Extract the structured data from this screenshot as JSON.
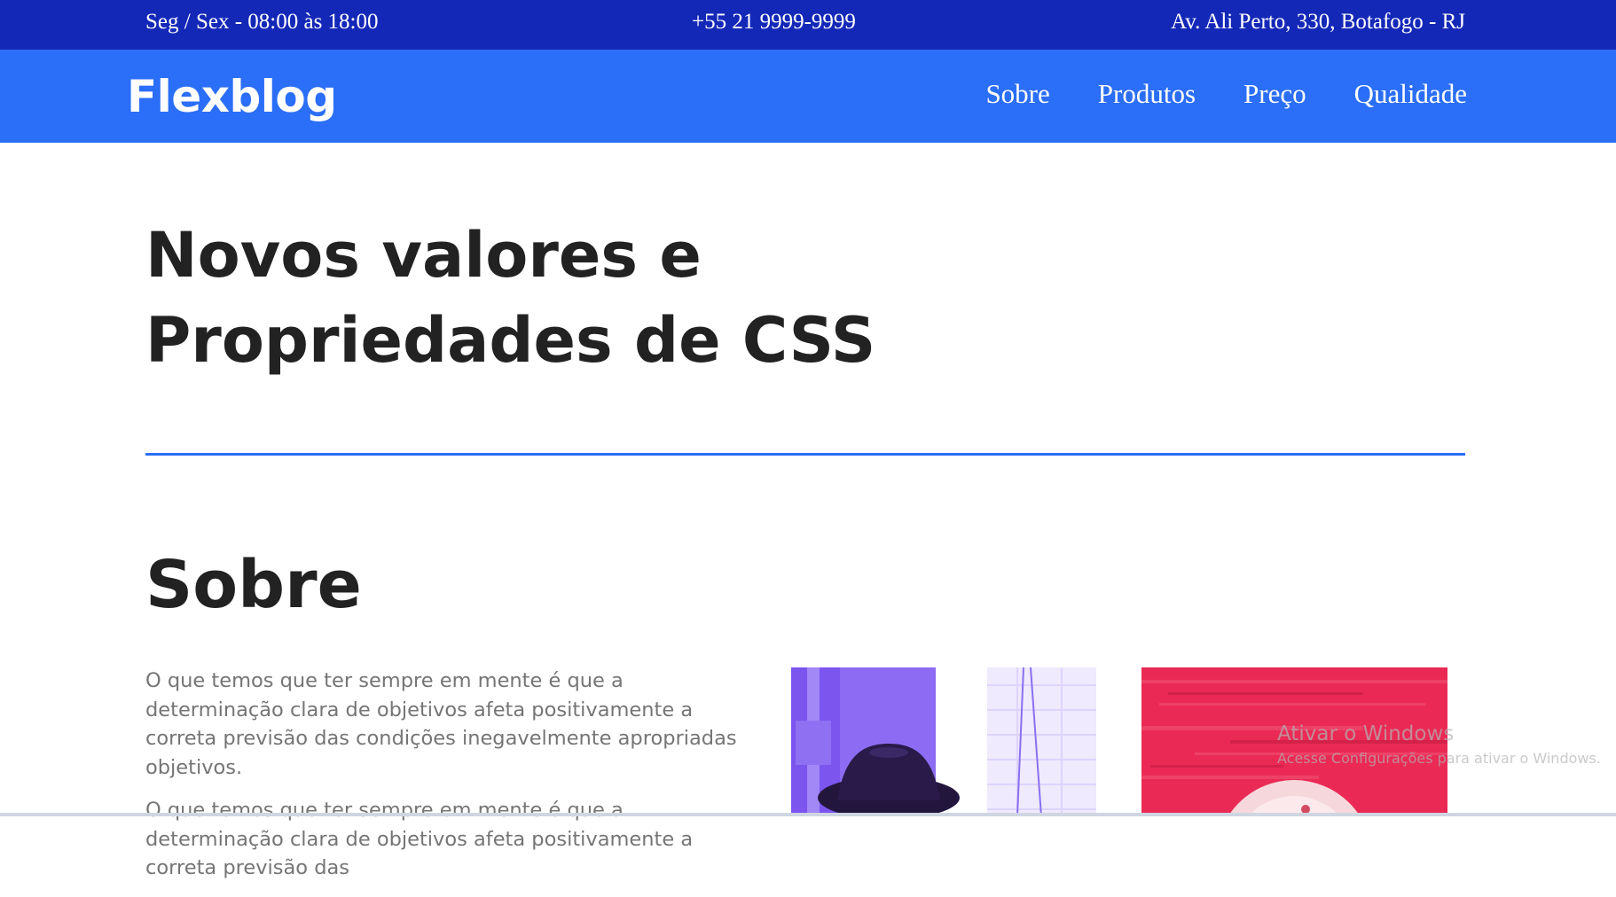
{
  "topbar": {
    "hours": "Seg / Sex - 08:00 às 18:00",
    "phone": "+55 21 9999-9999",
    "address": "Av. Ali Perto, 330, Botafogo - RJ",
    "background": "#1428b8"
  },
  "header": {
    "logo": "Flexblog",
    "background": "#2b6ef7",
    "nav": [
      {
        "label": "Sobre"
      },
      {
        "label": "Produtos"
      },
      {
        "label": "Preço"
      },
      {
        "label": "Qualidade"
      }
    ]
  },
  "hero": {
    "title_line1": "Novos valores e",
    "title_line2": "Propriedades de CSS",
    "divider_color": "#2b6ef7"
  },
  "about": {
    "title": "Sobre",
    "paragraphs": [
      "O que temos que ter sempre em mente é que a determinação clara de objetivos afeta positivamente a correta previsão das condições inegavelmente apropriadas objetivos.",
      "O que temos que ter sempre em mente é que a determinação clara de objetivos afeta positivamente a correta previsão das"
    ]
  },
  "watermark": {
    "title": "Ativar o Windows",
    "subtitle": "Acesse Configurações para ativar o Windows."
  }
}
